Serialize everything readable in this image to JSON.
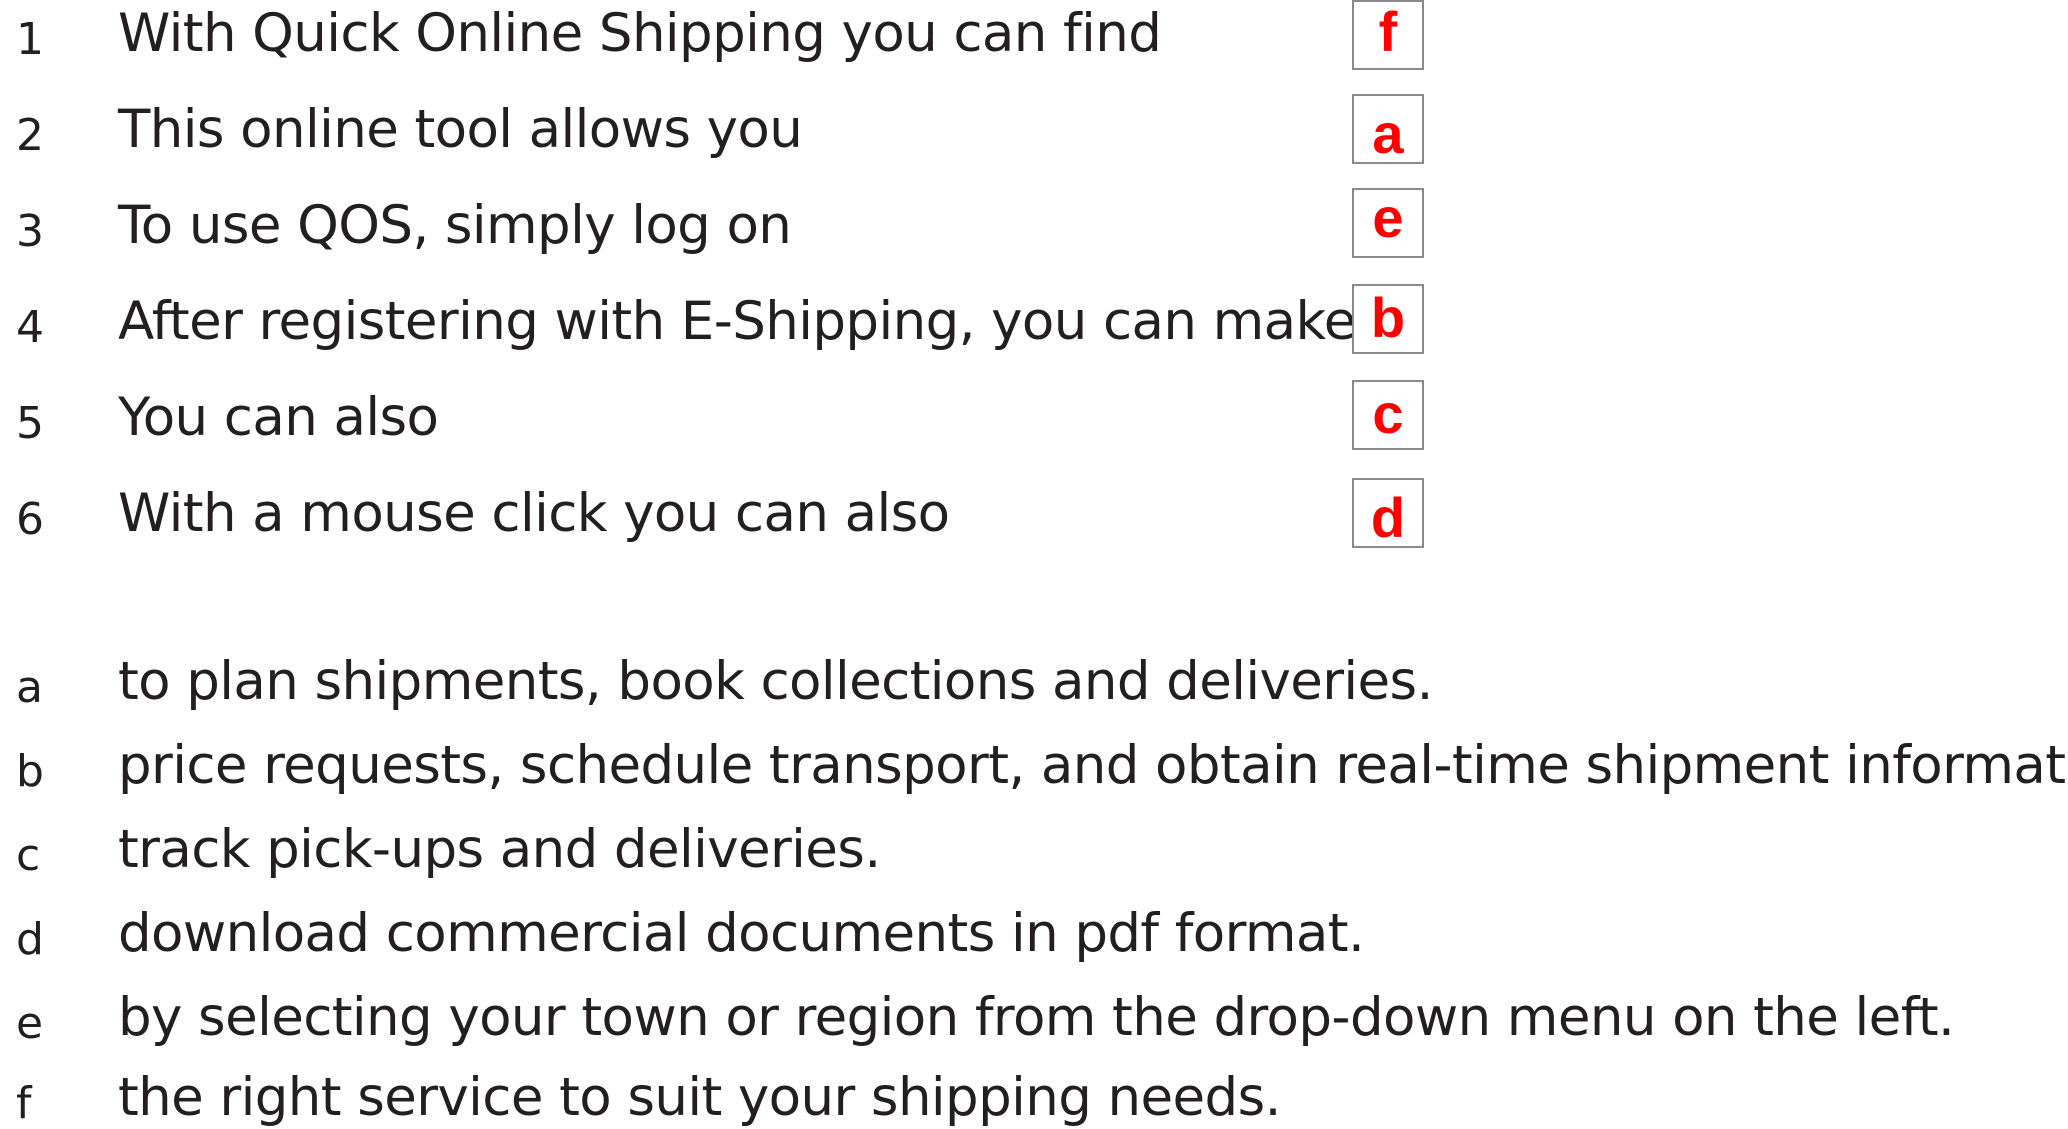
{
  "stems": [
    {
      "number": "1",
      "text": "With Quick Online Shipping you can find",
      "answer": "f"
    },
    {
      "number": "2",
      "text": "This online tool allows you",
      "answer": "a"
    },
    {
      "number": "3",
      "text": "To use QOS, simply log on",
      "answer": "e"
    },
    {
      "number": "4",
      "text": "After registering with E-Shipping, you can make",
      "answer": "b"
    },
    {
      "number": "5",
      "text": "You can also",
      "answer": "c"
    },
    {
      "number": "6",
      "text": "With a mouse click you can also",
      "answer": "d"
    }
  ],
  "endings": [
    {
      "letter": "a",
      "text": "to plan shipments, book collections and deliveries."
    },
    {
      "letter": "b",
      "text": "price requests, schedule transport, and obtain real-time shipment information."
    },
    {
      "letter": "c",
      "text": "track pick-ups and deliveries."
    },
    {
      "letter": "d",
      "text": "download commercial documents in pdf format."
    },
    {
      "letter": "e",
      "text": "by selecting your town or region from the drop-down menu on the left."
    },
    {
      "letter": "f",
      "text": "the right service to suit your shipping needs."
    }
  ],
  "colors": {
    "text": "#231f20",
    "answer": "#ff0000",
    "box_border": "#8a8a8a"
  }
}
